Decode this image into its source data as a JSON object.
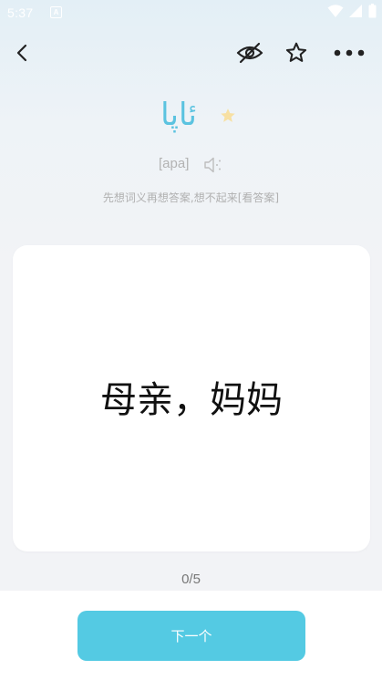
{
  "status_bar": {
    "time": "5:37",
    "notification_icon": "A",
    "icons": [
      "wifi-icon",
      "signal-icon",
      "battery-icon"
    ]
  },
  "toolbar": {
    "back_icon": "chevron-left-icon",
    "hide_icon": "eye-off-icon",
    "favorite_icon": "star-outline-icon",
    "more_icon": "more-horizontal-icon"
  },
  "word": {
    "text": "ئاپا",
    "star_icon": "star-filled-icon",
    "star_color": "#f7e0a3"
  },
  "phonetic": {
    "text": "[apa]",
    "speaker_icon": "speaker-icon"
  },
  "hint": {
    "text": "先想词义再想答案,想不起来",
    "link": "[看答案]"
  },
  "card": {
    "meaning": "母亲，妈妈"
  },
  "progress": {
    "text": "0/5",
    "current": 0,
    "total": 5
  },
  "bottom": {
    "next_label": "下一个"
  },
  "colors": {
    "accent": "#54cae3",
    "word": "#5bc3e0",
    "background": "#f2f3f6"
  }
}
